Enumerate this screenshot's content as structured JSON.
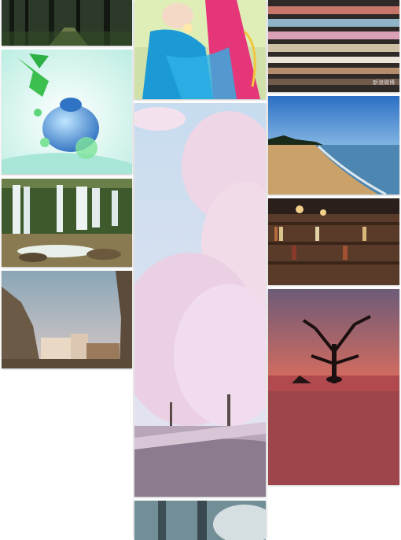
{
  "gallery": {
    "columns": [
      {
        "tiles": [
          {
            "subject": "forest-path"
          },
          {
            "subject": "blue-apple-perfume"
          },
          {
            "subject": "waterfall"
          },
          {
            "subject": "paris-street"
          }
        ]
      },
      {
        "tiles": [
          {
            "subject": "goddess-illustration"
          },
          {
            "subject": "cherry-blossom-path"
          },
          {
            "subject": "misty-forest"
          }
        ]
      },
      {
        "tiles": [
          {
            "subject": "ribbon-spools",
            "watermark": "新浪微博"
          },
          {
            "subject": "beach-shore"
          },
          {
            "subject": "bookshelf-room"
          },
          {
            "subject": "sunset-tree"
          }
        ]
      }
    ]
  },
  "colors": {
    "background": "#ffffff",
    "divider": "#e6e6e6"
  }
}
